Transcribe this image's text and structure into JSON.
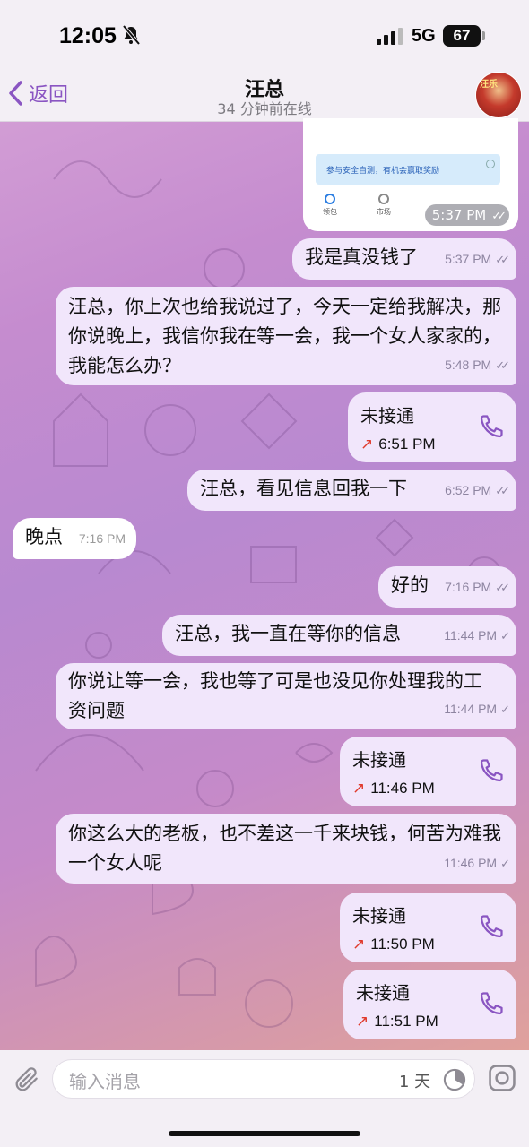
{
  "status_bar": {
    "time": "12:05",
    "network": "5G",
    "battery": "67"
  },
  "header": {
    "back_label": "返回",
    "title": "汪总",
    "subtitle": "34 分钟前在线",
    "avatar_text": "汪乐"
  },
  "image_message": {
    "banner_text": "参与安全自测，有机会赢取奖励",
    "tabs": [
      "领包",
      "市场",
      "",
      ""
    ],
    "time": "5:37 PM"
  },
  "messages": [
    {
      "dir": "out",
      "text": "我是真没钱了",
      "time": "5:37 PM",
      "status": "read"
    },
    {
      "dir": "out",
      "text": "汪总，你上次也给我说过了，今天一定给我解决，那你说晚上，我信你我在等一会，我一个女人家家的，我能怎么办？",
      "time": "5:48 PM",
      "status": "read"
    },
    {
      "dir": "out",
      "type": "call",
      "text": "未接通",
      "time": "6:51 PM"
    },
    {
      "dir": "out",
      "text": "汪总，看见信息回我一下",
      "time": "6:52 PM",
      "status": "read"
    },
    {
      "dir": "in",
      "text": "晚点",
      "time": "7:16 PM"
    },
    {
      "dir": "out",
      "text": "好的",
      "time": "7:16 PM",
      "status": "read"
    },
    {
      "dir": "out",
      "text": "汪总，我一直在等你的信息",
      "time": "11:44 PM",
      "status": "sent"
    },
    {
      "dir": "out",
      "text": "你说让等一会，我也等了可是也没见你处理我的工资问题",
      "time": "11:44 PM",
      "status": "sent"
    },
    {
      "dir": "out",
      "type": "call",
      "text": "未接通",
      "time": "11:46 PM"
    },
    {
      "dir": "out",
      "text": "你这么大的老板，也不差这一千来块钱，何苦为难我一个女人呢",
      "time": "11:46 PM",
      "status": "sent"
    },
    {
      "dir": "out",
      "type": "call",
      "text": "未接通",
      "time": "11:50 PM"
    },
    {
      "dir": "out",
      "type": "call",
      "text": "未接通",
      "time": "11:51 PM"
    }
  ],
  "input": {
    "placeholder": "输入消息",
    "timer_label": "1 天"
  },
  "colors": {
    "accent": "#8a55c2",
    "out_bubble": "#f1e6fb",
    "in_bubble": "#ffffff",
    "missed_arrow": "#e0392b"
  }
}
